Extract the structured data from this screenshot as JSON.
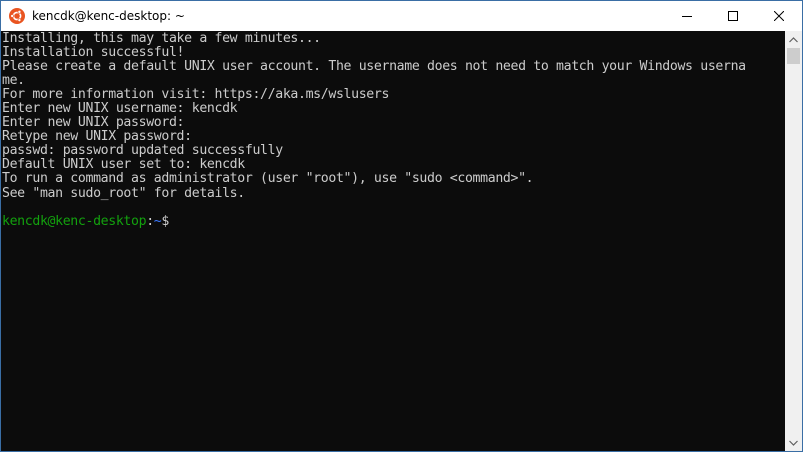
{
  "window": {
    "title": "kencdk@kenc-desktop: ~",
    "icon": "ubuntu-logo-icon",
    "controls": [
      "minimize-icon",
      "maximize-icon",
      "close-icon"
    ]
  },
  "terminal": {
    "lines": [
      "Installing, this may take a few minutes...",
      "Installation successful!",
      "Please create a default UNIX user account. The username does not need to match your Windows userna",
      "me.",
      "For more information visit: https://aka.ms/wslusers",
      "Enter new UNIX username: kencdk",
      "Enter new UNIX password:",
      "Retype new UNIX password:",
      "passwd: password updated successfully",
      "Default UNIX user set to: kencdk",
      "To run a command as administrator (user \"root\"), use \"sudo <command>\".",
      "See \"man sudo_root\" for details."
    ],
    "prompt": {
      "user_host": "kencdk@kenc-desktop",
      "separator": ":",
      "path": "~",
      "symbol": "$"
    }
  },
  "colors": {
    "background": "#0c0c0c",
    "text": "#cccccc",
    "prompt_user": "#13a10e",
    "prompt_path": "#3b78ff",
    "ubuntu_orange": "#e95420"
  }
}
